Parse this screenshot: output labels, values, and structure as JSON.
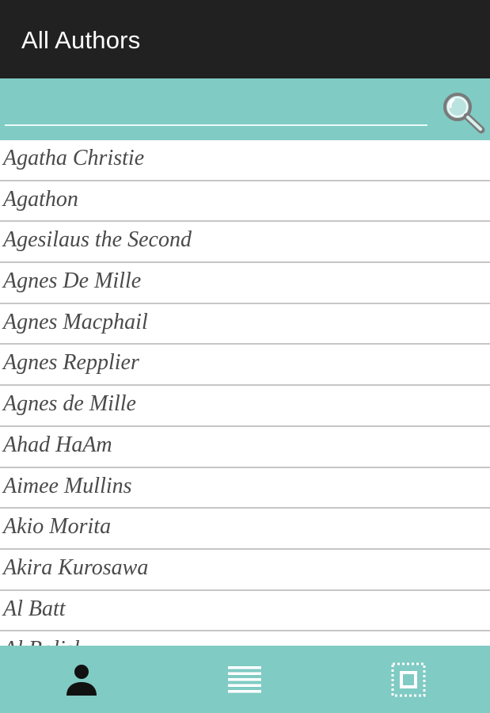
{
  "header": {
    "title": "All Authors",
    "background_color": "#212121",
    "title_color": "#ffffff"
  },
  "search": {
    "value": "",
    "placeholder": "",
    "icon": "search-icon"
  },
  "theme": {
    "accent_color": "#80cbc4"
  },
  "authors": [
    "Agatha Christie",
    "Agathon",
    "Agesilaus the Second",
    "Agnes De Mille",
    "Agnes Macphail",
    "Agnes Repplier",
    "Agnes de Mille",
    "Ahad HaAm",
    "Aimee Mullins",
    "Akio Morita",
    "Akira Kurosawa",
    "Al Batt",
    "Al Bolisk"
  ],
  "bottom_nav": {
    "tabs": [
      {
        "icon": "person-icon",
        "selected": true
      },
      {
        "icon": "list-icon",
        "selected": false
      },
      {
        "icon": "frame-icon",
        "selected": false
      }
    ]
  }
}
